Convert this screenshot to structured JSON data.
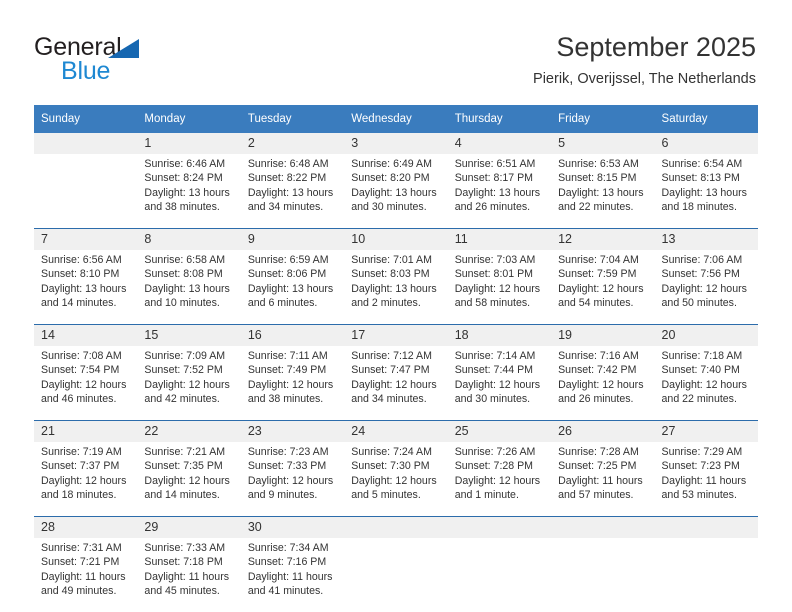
{
  "brand": {
    "name_part1": "General",
    "name_part2": "Blue",
    "accent_color": "#1e88d2",
    "triangle_color": "#1667b1"
  },
  "header": {
    "title": "September 2025",
    "subtitle": "Pierik, Overijssel, The Netherlands"
  },
  "calendar": {
    "header_bg": "#3a7cbe",
    "daynum_bg": "#f0f0f0",
    "separator_color": "#2c6cab",
    "weekdays": [
      "Sunday",
      "Monday",
      "Tuesday",
      "Wednesday",
      "Thursday",
      "Friday",
      "Saturday"
    ],
    "weeks": [
      [
        {
          "day": "",
          "sunrise": "",
          "sunset": "",
          "daylight1": "",
          "daylight2": ""
        },
        {
          "day": "1",
          "sunrise": "Sunrise: 6:46 AM",
          "sunset": "Sunset: 8:24 PM",
          "daylight1": "Daylight: 13 hours",
          "daylight2": "and 38 minutes."
        },
        {
          "day": "2",
          "sunrise": "Sunrise: 6:48 AM",
          "sunset": "Sunset: 8:22 PM",
          "daylight1": "Daylight: 13 hours",
          "daylight2": "and 34 minutes."
        },
        {
          "day": "3",
          "sunrise": "Sunrise: 6:49 AM",
          "sunset": "Sunset: 8:20 PM",
          "daylight1": "Daylight: 13 hours",
          "daylight2": "and 30 minutes."
        },
        {
          "day": "4",
          "sunrise": "Sunrise: 6:51 AM",
          "sunset": "Sunset: 8:17 PM",
          "daylight1": "Daylight: 13 hours",
          "daylight2": "and 26 minutes."
        },
        {
          "day": "5",
          "sunrise": "Sunrise: 6:53 AM",
          "sunset": "Sunset: 8:15 PM",
          "daylight1": "Daylight: 13 hours",
          "daylight2": "and 22 minutes."
        },
        {
          "day": "6",
          "sunrise": "Sunrise: 6:54 AM",
          "sunset": "Sunset: 8:13 PM",
          "daylight1": "Daylight: 13 hours",
          "daylight2": "and 18 minutes."
        }
      ],
      [
        {
          "day": "7",
          "sunrise": "Sunrise: 6:56 AM",
          "sunset": "Sunset: 8:10 PM",
          "daylight1": "Daylight: 13 hours",
          "daylight2": "and 14 minutes."
        },
        {
          "day": "8",
          "sunrise": "Sunrise: 6:58 AM",
          "sunset": "Sunset: 8:08 PM",
          "daylight1": "Daylight: 13 hours",
          "daylight2": "and 10 minutes."
        },
        {
          "day": "9",
          "sunrise": "Sunrise: 6:59 AM",
          "sunset": "Sunset: 8:06 PM",
          "daylight1": "Daylight: 13 hours",
          "daylight2": "and 6 minutes."
        },
        {
          "day": "10",
          "sunrise": "Sunrise: 7:01 AM",
          "sunset": "Sunset: 8:03 PM",
          "daylight1": "Daylight: 13 hours",
          "daylight2": "and 2 minutes."
        },
        {
          "day": "11",
          "sunrise": "Sunrise: 7:03 AM",
          "sunset": "Sunset: 8:01 PM",
          "daylight1": "Daylight: 12 hours",
          "daylight2": "and 58 minutes."
        },
        {
          "day": "12",
          "sunrise": "Sunrise: 7:04 AM",
          "sunset": "Sunset: 7:59 PM",
          "daylight1": "Daylight: 12 hours",
          "daylight2": "and 54 minutes."
        },
        {
          "day": "13",
          "sunrise": "Sunrise: 7:06 AM",
          "sunset": "Sunset: 7:56 PM",
          "daylight1": "Daylight: 12 hours",
          "daylight2": "and 50 minutes."
        }
      ],
      [
        {
          "day": "14",
          "sunrise": "Sunrise: 7:08 AM",
          "sunset": "Sunset: 7:54 PM",
          "daylight1": "Daylight: 12 hours",
          "daylight2": "and 46 minutes."
        },
        {
          "day": "15",
          "sunrise": "Sunrise: 7:09 AM",
          "sunset": "Sunset: 7:52 PM",
          "daylight1": "Daylight: 12 hours",
          "daylight2": "and 42 minutes."
        },
        {
          "day": "16",
          "sunrise": "Sunrise: 7:11 AM",
          "sunset": "Sunset: 7:49 PM",
          "daylight1": "Daylight: 12 hours",
          "daylight2": "and 38 minutes."
        },
        {
          "day": "17",
          "sunrise": "Sunrise: 7:12 AM",
          "sunset": "Sunset: 7:47 PM",
          "daylight1": "Daylight: 12 hours",
          "daylight2": "and 34 minutes."
        },
        {
          "day": "18",
          "sunrise": "Sunrise: 7:14 AM",
          "sunset": "Sunset: 7:44 PM",
          "daylight1": "Daylight: 12 hours",
          "daylight2": "and 30 minutes."
        },
        {
          "day": "19",
          "sunrise": "Sunrise: 7:16 AM",
          "sunset": "Sunset: 7:42 PM",
          "daylight1": "Daylight: 12 hours",
          "daylight2": "and 26 minutes."
        },
        {
          "day": "20",
          "sunrise": "Sunrise: 7:18 AM",
          "sunset": "Sunset: 7:40 PM",
          "daylight1": "Daylight: 12 hours",
          "daylight2": "and 22 minutes."
        }
      ],
      [
        {
          "day": "21",
          "sunrise": "Sunrise: 7:19 AM",
          "sunset": "Sunset: 7:37 PM",
          "daylight1": "Daylight: 12 hours",
          "daylight2": "and 18 minutes."
        },
        {
          "day": "22",
          "sunrise": "Sunrise: 7:21 AM",
          "sunset": "Sunset: 7:35 PM",
          "daylight1": "Daylight: 12 hours",
          "daylight2": "and 14 minutes."
        },
        {
          "day": "23",
          "sunrise": "Sunrise: 7:23 AM",
          "sunset": "Sunset: 7:33 PM",
          "daylight1": "Daylight: 12 hours",
          "daylight2": "and 9 minutes."
        },
        {
          "day": "24",
          "sunrise": "Sunrise: 7:24 AM",
          "sunset": "Sunset: 7:30 PM",
          "daylight1": "Daylight: 12 hours",
          "daylight2": "and 5 minutes."
        },
        {
          "day": "25",
          "sunrise": "Sunrise: 7:26 AM",
          "sunset": "Sunset: 7:28 PM",
          "daylight1": "Daylight: 12 hours",
          "daylight2": "and 1 minute."
        },
        {
          "day": "26",
          "sunrise": "Sunrise: 7:28 AM",
          "sunset": "Sunset: 7:25 PM",
          "daylight1": "Daylight: 11 hours",
          "daylight2": "and 57 minutes."
        },
        {
          "day": "27",
          "sunrise": "Sunrise: 7:29 AM",
          "sunset": "Sunset: 7:23 PM",
          "daylight1": "Daylight: 11 hours",
          "daylight2": "and 53 minutes."
        }
      ],
      [
        {
          "day": "28",
          "sunrise": "Sunrise: 7:31 AM",
          "sunset": "Sunset: 7:21 PM",
          "daylight1": "Daylight: 11 hours",
          "daylight2": "and 49 minutes."
        },
        {
          "day": "29",
          "sunrise": "Sunrise: 7:33 AM",
          "sunset": "Sunset: 7:18 PM",
          "daylight1": "Daylight: 11 hours",
          "daylight2": "and 45 minutes."
        },
        {
          "day": "30",
          "sunrise": "Sunrise: 7:34 AM",
          "sunset": "Sunset: 7:16 PM",
          "daylight1": "Daylight: 11 hours",
          "daylight2": "and 41 minutes."
        },
        {
          "day": "",
          "sunrise": "",
          "sunset": "",
          "daylight1": "",
          "daylight2": ""
        },
        {
          "day": "",
          "sunrise": "",
          "sunset": "",
          "daylight1": "",
          "daylight2": ""
        },
        {
          "day": "",
          "sunrise": "",
          "sunset": "",
          "daylight1": "",
          "daylight2": ""
        },
        {
          "day": "",
          "sunrise": "",
          "sunset": "",
          "daylight1": "",
          "daylight2": ""
        }
      ]
    ]
  }
}
